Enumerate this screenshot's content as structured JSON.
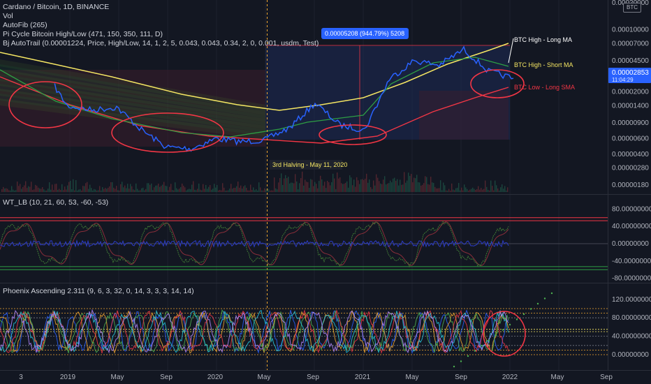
{
  "header": {
    "symbol_line": "Cardano / Bitcoin, 1D, BINANCE",
    "indicators": [
      "Vol",
      "AutoFib (265)",
      "Pi Cycle Bitcoin High/Low (471, 150, 350, 111, D)",
      "Bj AutoTrail (0.00001224, Price, High/Low, 14, 1, 2, 5, 0.043, 0.043, 0.34, 2, 0, 0.001, usdm, Test)"
    ]
  },
  "corner_badge": "BTC",
  "measure_label": "0.00005208 (944.79%) 5208",
  "halving_label": "3rd Halving - May 11, 2020",
  "ma_labels": {
    "high_long": "BTC High - Long MA",
    "high_short": "BTC High - Short MA",
    "low_long": "BTC Low - Long SMA"
  },
  "price_badge": {
    "price": "0.00002853",
    "countdown": "11:04:29"
  },
  "x_axis": [
    "3",
    "2019",
    "May",
    "Sep",
    "2020",
    "May",
    "Sep",
    "2021",
    "May",
    "Sep",
    "2022",
    "May",
    "Sep"
  ],
  "panes": {
    "wt_title": "WT_LB (10, 21, 60, 53, -60, -53)",
    "phoenix_title": "Phoenix Ascending 2.311 (9, 6, 3, 32, 0, 14, 3, 3, 3, 14, 14)"
  },
  "colors": {
    "background": "#131722",
    "price_line": "#2962ff",
    "annotation": "#f23645",
    "yellow_ma": "#f5e663",
    "green_ma": "#2e9f44",
    "badge": "#2962ff"
  },
  "chart_data": [
    {
      "type": "line",
      "title": "Cardano / Bitcoin, 1D, BINANCE",
      "scale": "log",
      "y_ticks": [
        "0.00020000",
        "0.00010000",
        "0.00007000",
        "0.00004500",
        "0.00003000",
        "0.00002000",
        "0.00001400",
        "0.00000900",
        "0.00000600",
        "0.00000400",
        "0.00000280",
        "0.00000180"
      ],
      "x_ticks": [
        "3",
        "2019",
        "May",
        "Sep",
        "2020",
        "May",
        "Sep",
        "2021",
        "May",
        "Sep",
        "2022",
        "May",
        "Sep"
      ],
      "series": [
        {
          "name": "Cardano / Bitcoin",
          "color": "#2962ff",
          "x": [
            "2018-12",
            "2019-01",
            "2019-03",
            "2019-05",
            "2019-07",
            "2019-09",
            "2019-11",
            "2020-01",
            "2020-03",
            "2020-05",
            "2020-07",
            "2020-09",
            "2020-11",
            "2021-01",
            "2021-03",
            "2021-05",
            "2021-07",
            "2021-09",
            "2021-11",
            "2022-01"
          ],
          "values": [
            2.3e-05,
            1.4e-05,
            1.25e-05,
            1.35e-05,
            7.5e-06,
            4.8e-06,
            4.6e-06,
            6e-06,
            5.5e-06,
            5.8e-06,
            8e-06,
            1.5e-05,
            8.5e-06,
            7.5e-06,
            2.8e-05,
            4.5e-05,
            4e-05,
            6e-05,
            3.4e-05,
            2.85e-05
          ]
        }
      ]
    },
    {
      "type": "line",
      "title": "WT_LB (10, 21, 60, 53, -60, -53)",
      "y_ticks": [
        "80.00000000",
        "40.00000000",
        "0.00000000",
        "-40.00000000",
        "-80.00000000"
      ],
      "ylim": [
        -80,
        80
      ]
    },
    {
      "type": "line",
      "title": "Phoenix Ascending 2.311 (9, 6, 3, 32, 0, 14, 3, 3, 3, 14, 14)",
      "y_ticks": [
        "120.00000000",
        "80.00000000",
        "40.00000000",
        "0.00000000"
      ],
      "ylim": [
        0,
        120
      ]
    }
  ]
}
